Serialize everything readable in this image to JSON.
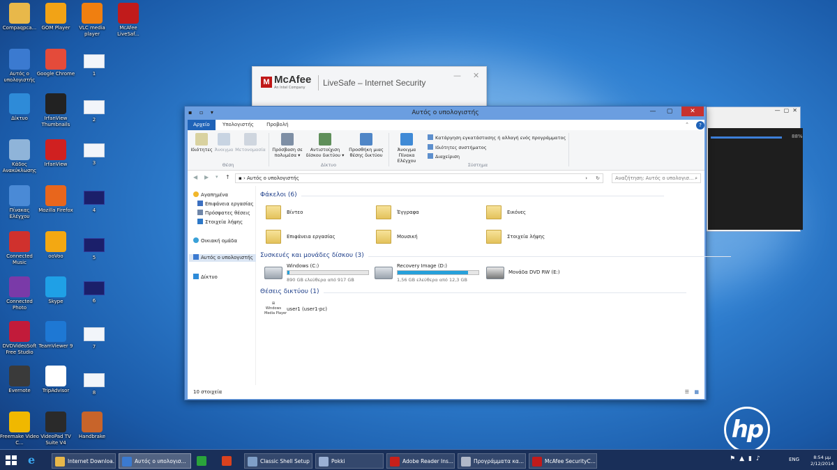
{
  "desktop": {
    "icons": [
      {
        "label": "Compaqpca...",
        "name": "compaq-icon",
        "color": "#e8b84a"
      },
      {
        "label": "GOM Player",
        "name": "gom-player-icon",
        "color": "#f2a316"
      },
      {
        "label": "VLC media player",
        "name": "vlc-icon",
        "color": "#f07f10"
      },
      {
        "label": "McAfee LiveSaf...",
        "name": "mcafee-livesafe-icon",
        "color": "#c11b1b"
      },
      {
        "label": "Αυτός ο υπολογιστής",
        "name": "this-pc-icon",
        "color": "#3b7ad0"
      },
      {
        "label": "Google Chrome",
        "name": "chrome-icon",
        "color": "#e44b3a"
      },
      {
        "label": "Δίκτυο",
        "name": "network-icon",
        "color": "#2e8bd8"
      },
      {
        "label": "IrfanView Thumbnails",
        "name": "irfanview-thumbnails-icon",
        "color": "#222222"
      },
      {
        "label": "Κάδος Ανακύκλωσης",
        "name": "recycle-bin-icon",
        "color": "#8fb4d9"
      },
      {
        "label": "IrfanView",
        "name": "irfanview-icon",
        "color": "#d02020"
      },
      {
        "label": "Πίνακας Ελέγχου",
        "name": "control-panel-icon",
        "color": "#4a8ad6"
      },
      {
        "label": "Mozilla Firefox",
        "name": "firefox-icon",
        "color": "#e8661c"
      },
      {
        "label": "Connected Music",
        "name": "connected-music-icon",
        "color": "#d0312d"
      },
      {
        "label": "ooVoo",
        "name": "oovoo-icon",
        "color": "#f3a812"
      },
      {
        "label": "Connected Photo",
        "name": "connected-photo-icon",
        "color": "#7a3aa8"
      },
      {
        "label": "Skype",
        "name": "skype-icon",
        "color": "#1fa0e6"
      },
      {
        "label": "DVDVideoSoft Free Studio",
        "name": "dvdvideosoft-icon",
        "color": "#c21b3a"
      },
      {
        "label": "TeamViewer 9",
        "name": "teamviewer-icon",
        "color": "#1e78d4"
      },
      {
        "label": "Evernote",
        "name": "evernote-icon",
        "color": "#3a3a3a"
      },
      {
        "label": "TripAdvisor",
        "name": "tripadvisor-icon",
        "color": "#ffffff"
      },
      {
        "label": "Freemake Video C...",
        "name": "freemake-icon",
        "color": "#f0b800"
      },
      {
        "label": "VideoPad TV Suite V4",
        "name": "videopad-icon",
        "color": "#2a2a2a"
      },
      {
        "label": "Handbrake",
        "name": "handbrake-icon",
        "color": "#c8642a"
      }
    ],
    "thumbnails": [
      "1",
      "2",
      "3",
      "4",
      "5",
      "6",
      "7",
      "8"
    ],
    "hp_logo": "hp"
  },
  "mcafee": {
    "brand": "McAfee",
    "brand_sub": "An Intel Company",
    "product": "LiveSafe – Internet Security",
    "minimize": "—",
    "close": "✕"
  },
  "progress_window": {
    "percent_label": "88%",
    "progress": 0.88
  },
  "explorer": {
    "title": "Αυτός ο υπολογιστής",
    "tabs": {
      "file": "Αρχείο",
      "computer": "Υπολογιστής",
      "view": "Προβολή"
    },
    "ribbon": {
      "properties": "Ιδιότητες",
      "open": "Άνοιγμα",
      "rename": "Μετονομασία",
      "group_location": "Θέση",
      "access_media": "Πρόσβαση σε πολυμέσα ▾",
      "map_drive": "Αντιστοίχιση δίσκου δικτύου ▾",
      "add_location": "Προσθήκη μιας θέσης δικτύου",
      "group_network": "Δίκτυο",
      "open_control_panel": "Άνοιγμα Πίνακα Ελέγχου",
      "uninstall": "Κατάργηση εγκατάστασης ή αλλαγή ενός προγράμματος",
      "system_properties": "Ιδιότητες συστήματος",
      "manage": "Διαχείριση",
      "group_system": "Σύστημα"
    },
    "address": "Αυτός ο υπολογιστής",
    "search_placeholder": "Αναζήτηση: Αυτός ο υπολογισ...",
    "nav": {
      "favorites": "Αγαπημένα",
      "desktop": "Επιφάνεια εργασίας",
      "recent": "Πρόσφατες θέσεις",
      "downloads": "Στοιχεία λήψης",
      "homegroup": "Οικιακή ομάδα",
      "this_pc": "Αυτός ο υπολογιστής",
      "network": "Δίκτυο"
    },
    "folders_header": "Φάκελοι (6)",
    "folders": [
      "Βίντεο",
      "Έγγραφα",
      "Εικόνες",
      "Επιφάνεια εργασίας",
      "Μουσική",
      "Στοιχεία λήψης"
    ],
    "devices_header": "Συσκευές και μονάδες δίσκου (3)",
    "drives": [
      {
        "name": "Windows (C:)",
        "free": "890 GB ελεύθερα από 917 GB",
        "used_fraction": 0.03
      },
      {
        "name": "Recovery Image (D:)",
        "free": "1,56 GB ελεύθερα από 12,3 GB",
        "used_fraction": 0.87
      }
    ],
    "dvd": "Μονάδα DVD RW (E:)",
    "network_header": "Θέσεις δικτύου (1)",
    "network_location": "user1 (user1-pc)",
    "status": "10 στοιχεία"
  },
  "taskbar": {
    "items": [
      {
        "label": "Internet Downloa...",
        "name": "taskbar-internet-download",
        "color": "#e8b84a",
        "state": "open"
      },
      {
        "label": "Αυτός ο υπολογισ...",
        "name": "taskbar-this-pc",
        "color": "#3b7ad0",
        "state": "active"
      },
      {
        "label": "",
        "name": "taskbar-app-green",
        "color": "#2aa33b",
        "state": "plain"
      },
      {
        "label": "",
        "name": "taskbar-app-colorful",
        "color": "#d9421f",
        "state": "plain"
      },
      {
        "label": "Classic Shell Setup",
        "name": "taskbar-classic-shell",
        "color": "#7f9fc8",
        "state": "open"
      },
      {
        "label": "Pokki",
        "name": "taskbar-pokki",
        "color": "#9ab0d4",
        "state": "open"
      },
      {
        "label": "Adobe Reader Ins...",
        "name": "taskbar-adobe-reader",
        "color": "#c8201a",
        "state": "open"
      },
      {
        "label": "Προγράμματα κα...",
        "name": "taskbar-programs",
        "color": "#b0b8c8",
        "state": "open"
      },
      {
        "label": "McAfee SecurityC...",
        "name": "taskbar-mcafee",
        "color": "#c11b1b",
        "state": "open"
      }
    ],
    "language": "ENG",
    "time": "8:54 μμ",
    "date": "2/12/2014"
  }
}
